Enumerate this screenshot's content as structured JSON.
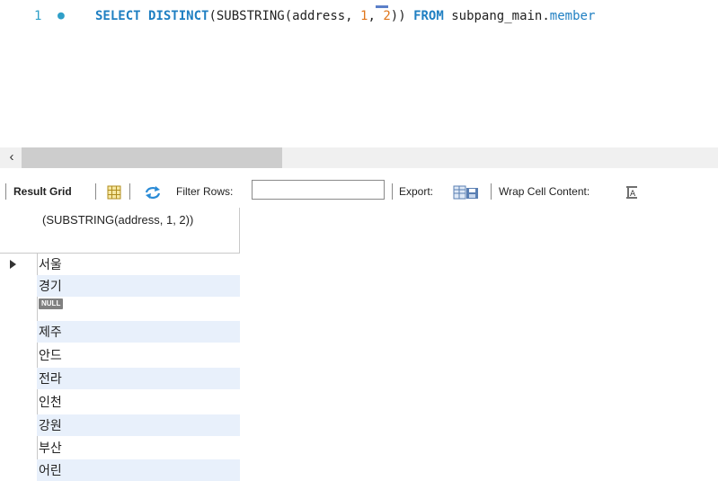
{
  "editor": {
    "line_number": "1",
    "sql": {
      "select": "SELECT",
      "distinct": "DISTINCT",
      "open1": "(SUBSTRING(address, ",
      "n1": "1",
      "comma": ", ",
      "n2": "2",
      "close": ")) ",
      "from": "FROM",
      "schema": " subpang_main.",
      "table": "member"
    }
  },
  "toolbar": {
    "result_grid_label": "Result Grid",
    "filter_rows_label": "Filter Rows:",
    "filter_rows_value": "",
    "export_label": "Export:",
    "wrap_label": "Wrap Cell Content:"
  },
  "grid": {
    "column_header": "(SUBSTRING(address, 1, 2))",
    "rows": [
      "서울",
      "경기",
      "NULL",
      "제주",
      "안드",
      "전라",
      "인천",
      "강원",
      "부산",
      "어린"
    ]
  },
  "colors": {
    "keyword": "#1f7fc2",
    "number": "#e0761c",
    "row_alt": "#e8f0fb"
  }
}
